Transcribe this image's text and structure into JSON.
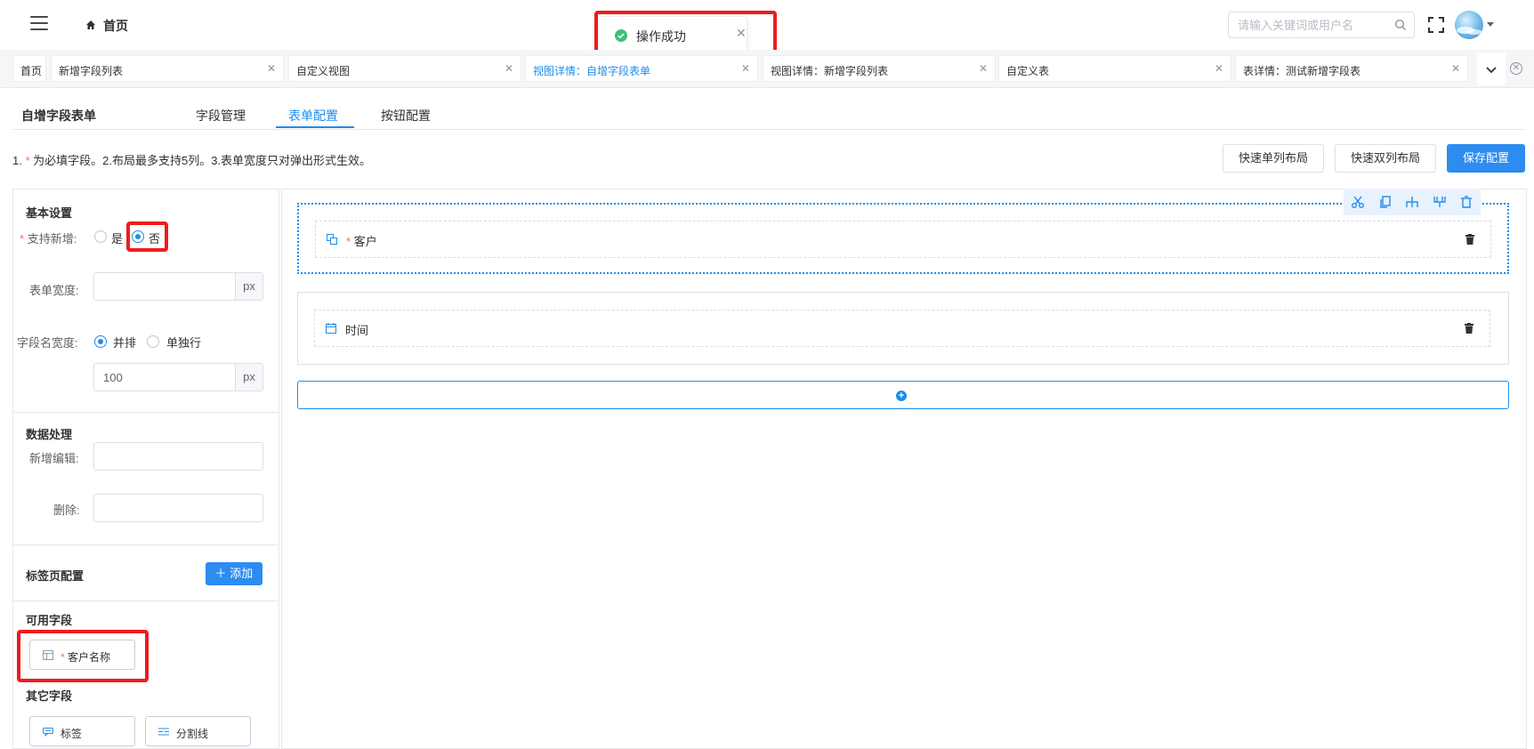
{
  "header": {
    "breadcrumb_home": "首页",
    "search_placeholder": "请输入关键词或用户名"
  },
  "toast": {
    "message": "操作成功"
  },
  "tabs": [
    {
      "label": "首页",
      "closable": false,
      "active": false
    },
    {
      "label": "新增字段列表",
      "closable": true,
      "active": false
    },
    {
      "label": "自定义视图",
      "closable": true,
      "active": false
    },
    {
      "label": "视图详情：自增字段表单",
      "closable": true,
      "active": true
    },
    {
      "label": "视图详情：新增字段列表",
      "closable": true,
      "active": false
    },
    {
      "label": "自定义表",
      "closable": true,
      "active": false
    },
    {
      "label": "表详情：测试新增字段表",
      "closable": true,
      "active": false
    }
  ],
  "page": {
    "title": "自增字段表单",
    "tabs": [
      "字段管理",
      "表单配置",
      "按钮配置"
    ],
    "active_tab": "表单配置",
    "hint_prefix": "1. ",
    "hint_star": "*",
    "hint_rest": " 为必填字段。2.布局最多支持5列。3.表单宽度只对弹出形式生效。",
    "buttons": {
      "quick_single": "快速单列布局",
      "quick_double": "快速双列布局",
      "save": "保存配置"
    }
  },
  "left_panel": {
    "basic": {
      "title": "基本设置",
      "support_add_label": "支持新增:",
      "support_add_options": [
        "是",
        "否"
      ],
      "support_add_value": "否",
      "form_width_label": "表单宽度:",
      "form_width_value": "",
      "form_width_unit": "px",
      "field_name_width_label": "字段名宽度:",
      "field_name_width_options": [
        "并排",
        "单独行"
      ],
      "field_name_width_value": "并排",
      "field_name_width_px": "100",
      "field_name_width_unit": "px"
    },
    "data": {
      "title": "数据处理",
      "add_edit_label": "新增编辑:",
      "add_edit_value": "",
      "delete_label": "删除:",
      "delete_value": ""
    },
    "tab_config": {
      "title": "标签页配置",
      "add_button": "添加"
    },
    "available_fields": {
      "title": "可用字段",
      "items": [
        "客户名称"
      ]
    },
    "other_fields": {
      "title": "其它字段",
      "items": [
        "标签",
        "分割线"
      ]
    }
  },
  "canvas": {
    "rows": [
      {
        "field": "客户",
        "required": true,
        "selected": true
      },
      {
        "field": "时间",
        "required": false,
        "selected": false
      }
    ]
  },
  "colors": {
    "accent": "#1f8ceb",
    "required": "#f56c6c",
    "success": "#3ec07a",
    "highlight": "#ee1c1c"
  }
}
